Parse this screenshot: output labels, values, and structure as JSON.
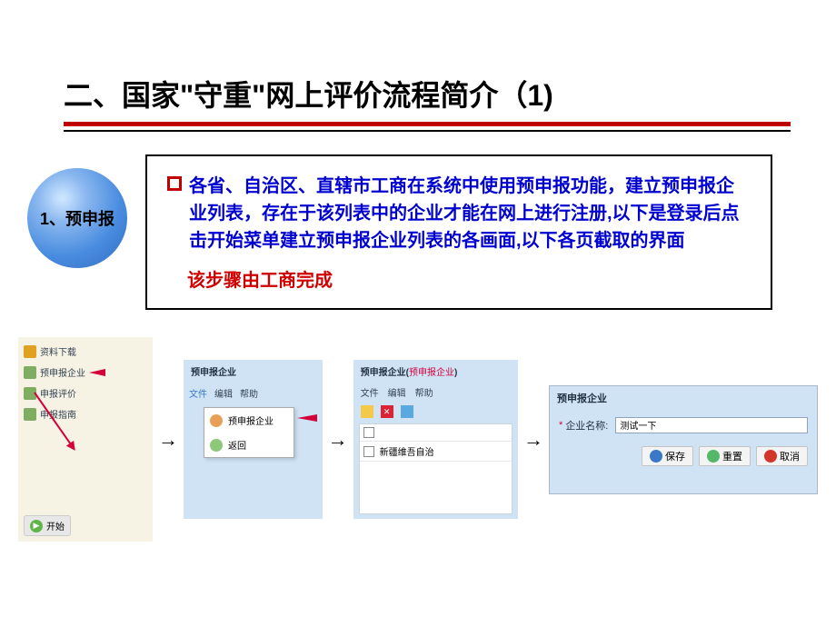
{
  "title": "二、国家\"守重\"网上评价流程简介（1)",
  "step_label": "1、预申报",
  "main_text": "各省、自治区、直辖市工商在系统中使用预申报功能，建立预申报企业列表，存在于该列表中的企业才能在网上进行注册,以下是登录后点击开始菜单建立预申报企业列表的各画面,以下各页截取的界面",
  "note": "该步骤由工商完成",
  "shot1": {
    "items": [
      "资料下载",
      "预申报企业",
      "申报评价",
      "申报指南"
    ],
    "start": "开始"
  },
  "shot2": {
    "title": "预申报企业",
    "toolbar": [
      "文件",
      "编辑",
      "帮助"
    ],
    "dropdown": [
      "预申报企业",
      "返回"
    ]
  },
  "shot3": {
    "title_a": "预申报企业(",
    "title_b": "预申报企业",
    "title_c": ")",
    "toolbar": [
      "文件",
      "编辑",
      "帮助"
    ],
    "row1": "新疆维吾自治"
  },
  "shot4": {
    "title": "预申报企业",
    "label": "企业名称:",
    "value": "测试一下",
    "save": "保存",
    "reset": "重置",
    "cancel": "取消"
  }
}
